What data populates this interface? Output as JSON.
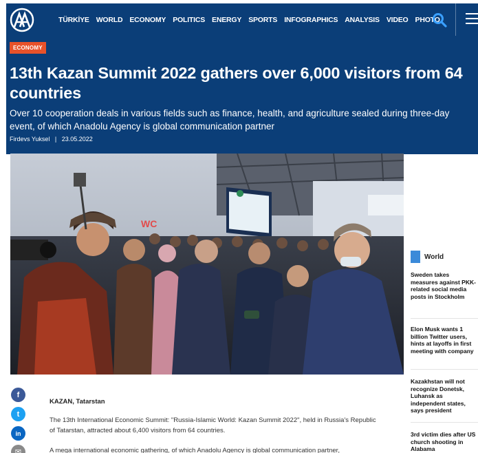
{
  "nav": {
    "logo_text": "AA",
    "items": [
      "TÜRKİYE",
      "WORLD",
      "ECONOMY",
      "POLITICS",
      "ENERGY",
      "SPORTS",
      "INFOGRAPHICS",
      "ANALYSIS",
      "VIDEO",
      "PHOTO"
    ],
    "search_icon": "search-icon",
    "menu_icon": "hamburger-menu-icon"
  },
  "article": {
    "category": "ECONOMY",
    "title": "13th Kazan Summit 2022 gathers over 6,000 visitors from 64 countries",
    "subtitle": "Over 10 cooperation deals in various fields such as finance, health, and agriculture sealed during three-day event, of which Anadolu Agency is global communication partner",
    "author": "Firdevs Yuksel",
    "separator": "|",
    "date": "23.05.2022",
    "dateline": "KAZAN, Tatarstan",
    "paragraphs": [
      "The 13th International Economic Summit: \"Russia-Islamic World: Kazan Summit 2022\", held in Russia's Republic of Tatarstan, attracted about 6,400 visitors from 64 countries.",
      "A mega international economic gathering, of which Anadolu Agency is global communication partner,"
    ],
    "photo_sign": "WC"
  },
  "share": [
    {
      "name": "facebook-icon",
      "glyph": "f",
      "color": "#3b5998"
    },
    {
      "name": "twitter-icon",
      "glyph": "t",
      "color": "#1da1f2"
    },
    {
      "name": "linkedin-icon",
      "glyph": "in",
      "color": "#0a66c2"
    },
    {
      "name": "email-icon",
      "glyph": "✉",
      "color": "#8a8a8a"
    }
  ],
  "sidebar": {
    "heading": "World",
    "items": [
      "Sweden takes measures against PKK-related social media posts in Stockholm",
      "Elon Musk wants 1 billion Twitter users, hints at layoffs in first meeting with company",
      "Kazakhstan will not recognize Donetsk, Luhansk as independent states, says president",
      "3rd victim dies after US church shooting in Alabama"
    ]
  },
  "colors": {
    "brand_blue": "#0b3e78",
    "badge_orange": "#e8522a",
    "sidebar_accent": "#3b8ad9"
  }
}
